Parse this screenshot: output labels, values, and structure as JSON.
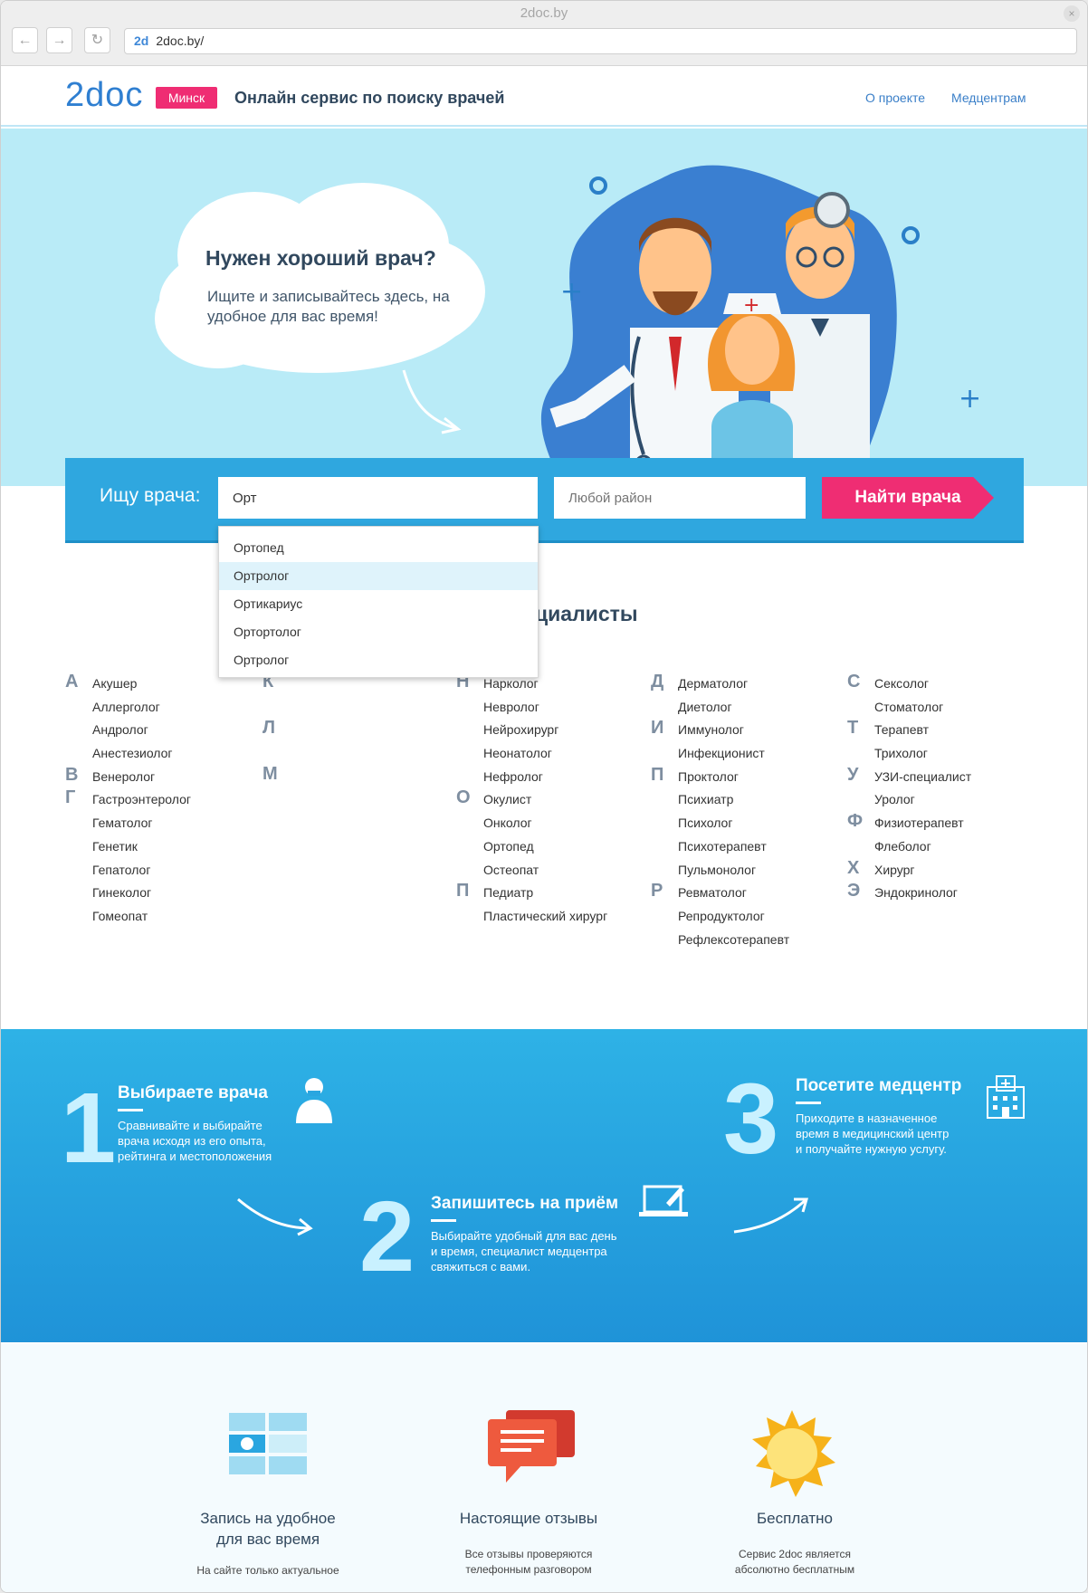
{
  "browser": {
    "window_title": "2doc.by",
    "url": "2doc.by/",
    "favicon_text": "2d",
    "close_glyph": "×",
    "back_glyph": "←",
    "forward_glyph": "→",
    "reload_glyph": "↻"
  },
  "header": {
    "logo": "2doc",
    "city": "Минск",
    "tagline": "Онлайн сервис по поиску врачей",
    "nav": [
      "О проекте",
      "Медцентрам"
    ]
  },
  "hero": {
    "title": "Нужен хороший врач?",
    "subtitle": "Ищите и записывайтесь здесь, на удобное для вас время!"
  },
  "search": {
    "label": "Ищу врача:",
    "query": "Орт",
    "district_placeholder": "Любой район",
    "button": "Найти врача",
    "suggestions": [
      "Ортопед",
      "Ортролог",
      "Ортикариус",
      "Ортортолог",
      "Ортролог"
    ],
    "selected_index": 1
  },
  "specialists": {
    "title_visible": "циалисты",
    "col1": [
      {
        "letter": "А",
        "name": "Акушер"
      },
      {
        "letter": "",
        "name": "Аллерголог"
      },
      {
        "letter": "",
        "name": "Андролог"
      },
      {
        "letter": "",
        "name": "Анестезиолог"
      },
      {
        "letter": "В",
        "name": "Венеролог"
      },
      {
        "letter": "Г",
        "name": "Гастроэнтеролог"
      },
      {
        "letter": "",
        "name": "Гематолог"
      },
      {
        "letter": "",
        "name": "Генетик"
      },
      {
        "letter": "",
        "name": "Гепатолог"
      },
      {
        "letter": "",
        "name": "Гинеколог"
      },
      {
        "letter": "",
        "name": "Гомеопат"
      }
    ],
    "col2_letters": [
      "К",
      "Л",
      "М"
    ],
    "col3": [
      {
        "letter": "Н",
        "name": "Нарколог"
      },
      {
        "letter": "",
        "name": "Невролог"
      },
      {
        "letter": "",
        "name": "Нейрохирург"
      },
      {
        "letter": "",
        "name": "Неонатолог"
      },
      {
        "letter": "",
        "name": "Нефролог"
      },
      {
        "letter": "О",
        "name": "Окулист"
      },
      {
        "letter": "",
        "name": "Онколог"
      },
      {
        "letter": "",
        "name": "Ортопед"
      },
      {
        "letter": "",
        "name": "Остеопат"
      },
      {
        "letter": "П",
        "name": "Педиатр"
      },
      {
        "letter": "",
        "name": "Пластический хирург"
      }
    ],
    "col4": [
      {
        "letter": "Д",
        "name": "Дерматолог"
      },
      {
        "letter": "",
        "name": "Диетолог"
      },
      {
        "letter": "И",
        "name": "Иммунолог"
      },
      {
        "letter": "",
        "name": "Инфекционист"
      },
      {
        "letter": "П",
        "name": "Проктолог"
      },
      {
        "letter": "",
        "name": "Психиатр"
      },
      {
        "letter": "",
        "name": "Психолог"
      },
      {
        "letter": "",
        "name": "Психотерапевт"
      },
      {
        "letter": "",
        "name": "Пульмонолог"
      },
      {
        "letter": "Р",
        "name": "Ревматолог"
      },
      {
        "letter": "",
        "name": "Репродуктолог"
      },
      {
        "letter": "",
        "name": "Рефлексотерапевт"
      }
    ],
    "col5": [
      {
        "letter": "С",
        "name": "Сексолог"
      },
      {
        "letter": "",
        "name": "Стоматолог"
      },
      {
        "letter": "Т",
        "name": "Терапевт"
      },
      {
        "letter": "",
        "name": "Трихолог"
      },
      {
        "letter": "У",
        "name": "УЗИ-специалист"
      },
      {
        "letter": "",
        "name": "Уролог"
      },
      {
        "letter": "Ф",
        "name": "Физиотерапевт"
      },
      {
        "letter": "",
        "name": "Флеболог"
      },
      {
        "letter": "Х",
        "name": "Хирург"
      },
      {
        "letter": "Э",
        "name": "Эндокринолог"
      }
    ]
  },
  "steps": [
    {
      "num": "1",
      "title": "Выбираете врача",
      "desc": [
        "Сравнивайте и выбирайте",
        "врача исходя из его опыта,",
        "рейтинга и местоположения"
      ],
      "icon": "doctor-icon"
    },
    {
      "num": "2",
      "title": "Запишитесь на приём",
      "desc": [
        "Выбирайте удобный для вас день",
        "и время, специалист медцентра",
        "свяжиться с вами."
      ],
      "icon": "laptop-edit-icon"
    },
    {
      "num": "3",
      "title": "Посетите медцентр",
      "desc": [
        "Приходите в назначенное",
        "время в медицинский центр",
        "и получайте нужную услугу."
      ],
      "icon": "hospital-icon"
    }
  ],
  "features": [
    {
      "title": [
        "Запись на удобное",
        "для вас время"
      ],
      "desc": [
        "На сайте только актуальное"
      ],
      "icon": "calendar-icon"
    },
    {
      "title": [
        "Настоящие отзывы"
      ],
      "desc": [
        "Все отзывы проверяются",
        "телефонным разговором"
      ],
      "icon": "chat-icon"
    },
    {
      "title": [
        "Бесплатно"
      ],
      "desc": [
        "Сервис 2doc является",
        "абсолютно бесплатным"
      ],
      "icon": "sun-icon"
    }
  ],
  "colors": {
    "brand_blue": "#2f7fd1",
    "accent_pink": "#ef2d73",
    "hero_bg": "#b9ebf7",
    "search_bg": "#2fa7df"
  }
}
